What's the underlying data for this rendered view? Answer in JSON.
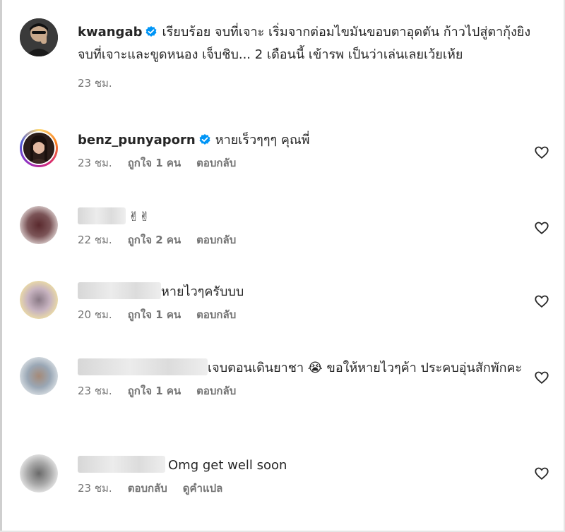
{
  "caption": {
    "username": "kwangab",
    "text": "เรียบร้อย จบที่เจาะ เริ่มจากต่อมไขมันขอบตาอุดตัน ก้าวไปสู่ตากุ้งยิง จบที่เจาะและขูดหนอง เจ็บชิบ... 2 เดือนนี้ เข้ารพ เป็นว่าเล่นเลยเว้ยเห้ย",
    "time": "23 ชม."
  },
  "comments": [
    {
      "username": "benz_punyaporn",
      "text": "หายเร็วๆๆๆ คุณพี่",
      "time": "23 ชม.",
      "likes": "ถูกใจ 1 คน",
      "reply": "ตอบกลับ"
    },
    {
      "username": "",
      "text": "✌✌",
      "time": "22 ชม.",
      "likes": "ถูกใจ 2 คน",
      "reply": "ตอบกลับ"
    },
    {
      "username": "",
      "text": "หายไวๆครับบบ",
      "time": "20 ชม.",
      "likes": "ถูกใจ 1 คน",
      "reply": "ตอบกลับ"
    },
    {
      "username": "",
      "text": "เจบตอนเดินยาชา 😭 ขอให้หายไวๆค้า ประคบอุ่นสักพักคะ",
      "time": "23 ชม.",
      "likes": "ถูกใจ 1 คน",
      "reply": "ตอบกลับ"
    },
    {
      "username": "",
      "text": "Omg get well soon",
      "time": "23 ชม.",
      "reply": "ตอบกลับ",
      "translate": "ดูคำแปล"
    }
  ],
  "icons": {
    "verified": "verified-badge-icon",
    "like": "heart-outline-icon"
  },
  "colors": {
    "verified": "#0095f6",
    "text": "#262626",
    "meta": "#737373"
  }
}
